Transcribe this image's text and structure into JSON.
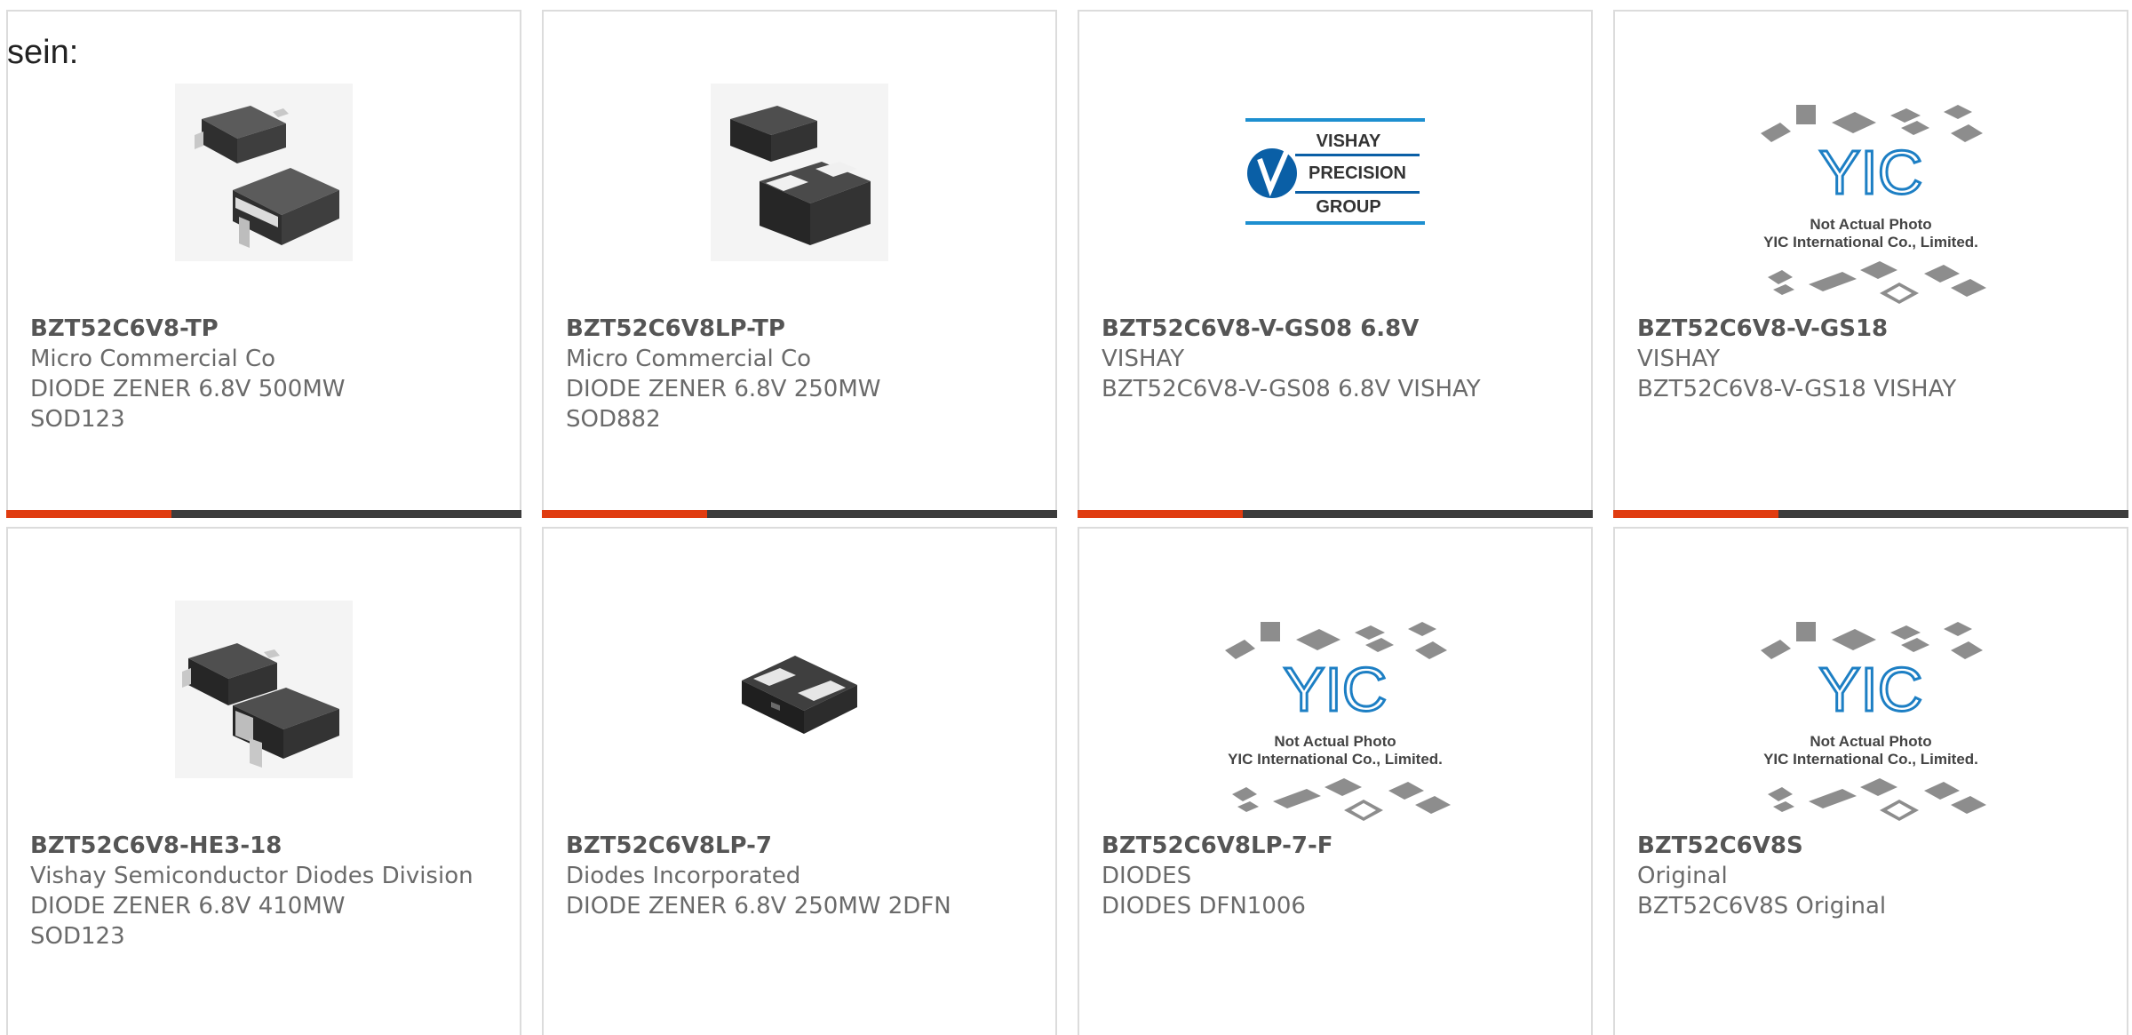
{
  "lead_text": "sein:",
  "products": [
    {
      "part_number": "BZT52C6V8-TP",
      "manufacturer": "Micro Commercial Co",
      "lines": [
        "DIODE ZENER 6.8V 500MW",
        "SOD123"
      ],
      "image": "sod123-diode-photo"
    },
    {
      "part_number": "BZT52C6V8LP-TP",
      "manufacturer": "Micro Commercial Co",
      "lines": [
        "DIODE ZENER 6.8V 250MW",
        "SOD882"
      ],
      "image": "sod882-diode-photo"
    },
    {
      "part_number": "BZT52C6V8-V-GS08 6.8V",
      "manufacturer": "VISHAY",
      "lines": [
        "BZT52C6V8-V-GS08 6.8V VISHAY"
      ],
      "image": "vishay-precision-group-logo",
      "logo_text": [
        "VISHAY",
        "PRECISION",
        "GROUP"
      ]
    },
    {
      "part_number": "BZT52C6V8-V-GS18",
      "manufacturer": "VISHAY",
      "lines": [
        "BZT52C6V8-V-GS18 VISHAY"
      ],
      "image": "yic-placeholder",
      "placeholder_text": [
        "Not Actual Photo",
        "YIC International Co., Limited."
      ]
    },
    {
      "part_number": "BZT52C6V8-HE3-18",
      "manufacturer": "Vishay Semiconductor Diodes Division",
      "lines": [
        "DIODE ZENER 6.8V 410MW",
        "SOD123"
      ],
      "image": "sod123-diode-photo"
    },
    {
      "part_number": "BZT52C6V8LP-7",
      "manufacturer": "Diodes Incorporated",
      "lines": [
        "DIODE ZENER 6.8V 250MW 2DFN"
      ],
      "image": "dfn-diode-photo"
    },
    {
      "part_number": "BZT52C6V8LP-7-F",
      "manufacturer": "DIODES",
      "lines": [
        "DIODES DFN1006"
      ],
      "image": "yic-placeholder",
      "placeholder_text": [
        "Not Actual Photo",
        "YIC International Co., Limited."
      ]
    },
    {
      "part_number": "BZT52C6V8S",
      "manufacturer": "Original",
      "lines": [
        "BZT52C6V8S Original"
      ],
      "image": "yic-placeholder",
      "placeholder_text": [
        "Not Actual Photo",
        "YIC International Co., Limited."
      ]
    }
  ],
  "colors": {
    "accent_bar": "#e03c10",
    "dark_bar": "#3c3c3c",
    "vishay_blue": "#0a5fa6",
    "yic_blue": "#1d7fc4"
  },
  "brand_text": {
    "yic_logo": "YIC"
  }
}
